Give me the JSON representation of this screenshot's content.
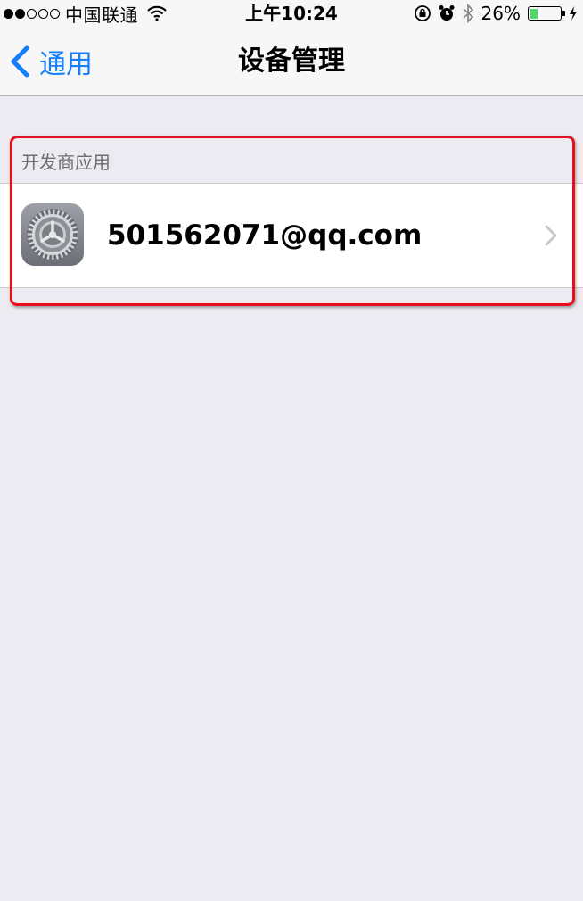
{
  "status_bar": {
    "carrier": "中国联通",
    "time": "上午10:24",
    "battery_percent": "26%",
    "battery_level": 0.26,
    "signal_bars_filled": 2,
    "signal_bars_total": 5,
    "icons": [
      "wifi-icon",
      "orientation-lock-icon",
      "alarm-icon",
      "bluetooth-icon",
      "battery-icon",
      "charging-icon"
    ]
  },
  "nav": {
    "back_label": "通用",
    "title": "设备管理"
  },
  "section": {
    "header": "开发商应用",
    "rows": [
      {
        "label": "501562071@qq.com",
        "icon": "settings-gear-icon"
      }
    ]
  },
  "colors": {
    "accent": "#157efb",
    "highlight": "#e8101e",
    "background": "#ebebf1",
    "battery_fill": "#4cd964"
  }
}
